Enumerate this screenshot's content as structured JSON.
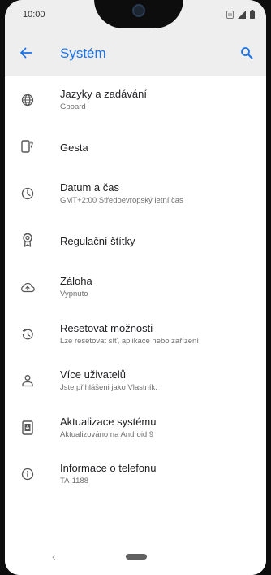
{
  "status_bar": {
    "time": "10:00",
    "icons": [
      "nfc-icon",
      "signal-icon",
      "battery-icon"
    ]
  },
  "app_bar": {
    "title": "Systém",
    "back_icon": "arrow-back-icon",
    "search_icon": "search-icon"
  },
  "accent_color": "#1a73e8",
  "items": [
    {
      "title": "Jazyky a zadávání",
      "subtitle": "Gboard",
      "icon": "globe-icon"
    },
    {
      "title": "Gesta",
      "subtitle": "",
      "icon": "gestures-icon"
    },
    {
      "title": "Datum a čas",
      "subtitle": "GMT+2:00 Středoevropský letní čas",
      "icon": "clock-icon"
    },
    {
      "title": "Regulační štítky",
      "subtitle": "",
      "icon": "badge-icon"
    },
    {
      "title": "Záloha",
      "subtitle": "Vypnuto",
      "icon": "cloud-backup-icon"
    },
    {
      "title": "Resetovat možnosti",
      "subtitle": "Lze resetovat síť, aplikace nebo zařízení",
      "icon": "history-reset-icon"
    },
    {
      "title": "Více uživatelů",
      "subtitle": "Jste přihlášeni jako Vlastník.",
      "icon": "user-icon"
    },
    {
      "title": "Aktualizace systému",
      "subtitle": "Aktualizováno na Android 9",
      "icon": "system-update-icon"
    },
    {
      "title": "Informace o telefonu",
      "subtitle": "TA-1188",
      "icon": "info-icon"
    }
  ],
  "nav_bar": {
    "back_glyph": "‹",
    "home_icon": "home-pill-icon"
  }
}
